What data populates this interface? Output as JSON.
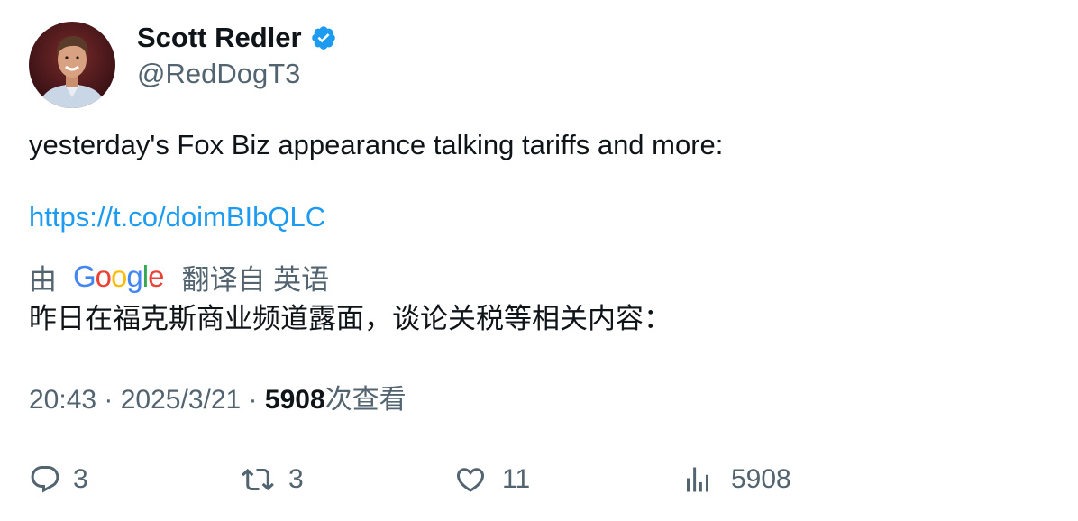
{
  "author": {
    "display_name": "Scott Redler",
    "handle": "@RedDogT3"
  },
  "tweet": {
    "text": "yesterday's Fox Biz appearance talking tariffs and more:",
    "link": "https://t.co/doimBIbQLC"
  },
  "translation": {
    "by_label": "由",
    "provider_letters": [
      "G",
      "o",
      "o",
      "g",
      "l",
      "e"
    ],
    "provider_colors": [
      "#4285F4",
      "#EA4335",
      "#FBBC05",
      "#4285F4",
      "#34A853",
      "#EA4335"
    ],
    "from_label": "翻译自 英语",
    "text": "昨日在福克斯商业频道露面，谈论关税等相关内容："
  },
  "meta": {
    "time": "20:43",
    "separator": " · ",
    "date": "2025/3/21",
    "views": "5908",
    "views_label": "次查看"
  },
  "actions": {
    "replies": "3",
    "retweets": "3",
    "likes": "11",
    "views": "5908"
  },
  "colors": {
    "link": "#1d9bf0",
    "secondary_text": "#536471",
    "primary_text": "#0f1419",
    "verified": "#1d9bf0"
  },
  "icons": [
    "verified-badge-icon",
    "reply-icon",
    "retweet-icon",
    "like-icon",
    "views-icon"
  ]
}
